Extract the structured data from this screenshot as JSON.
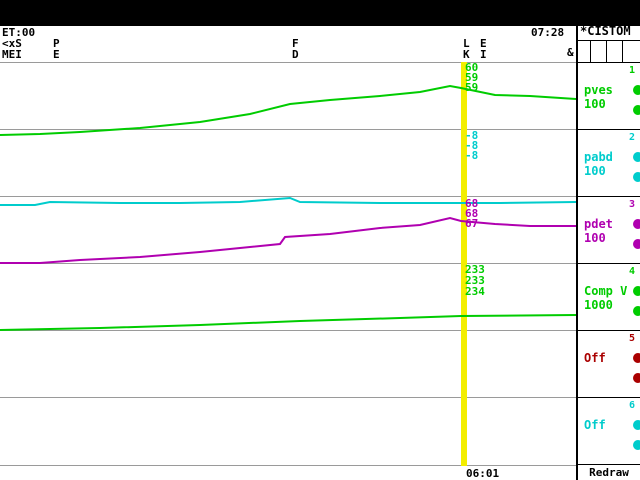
{
  "header": {
    "left_clock": "ET:00",
    "right_clock": "07:28",
    "title": "*CISTOM",
    "mode_labels": [
      "<xS",
      "MEI"
    ]
  },
  "markers": [
    {
      "label": "P\nE"
    },
    {
      "label": "F\nD"
    },
    {
      "label": "L\nK"
    },
    {
      "label": "E\nI"
    },
    {
      "label": "&"
    }
  ],
  "cursor": {
    "time": "06:01",
    "values": {
      "pves": [
        "60",
        "59",
        "59"
      ],
      "pabd": [
        "-8",
        "-8",
        "-8"
      ],
      "pdet": [
        "68",
        "68",
        "67"
      ],
      "compv": [
        "233",
        "233",
        "234"
      ]
    }
  },
  "channels": [
    {
      "num": "1",
      "name": "pves",
      "scale": "100",
      "color": "#00cc00"
    },
    {
      "num": "2",
      "name": "pabd",
      "scale": "100",
      "color": "#00cccc"
    },
    {
      "num": "3",
      "name": "pdet",
      "scale": "100",
      "color": "#b000b0"
    },
    {
      "num": "4",
      "name": "Comp V",
      "scale": "1000",
      "color": "#00cc00"
    },
    {
      "num": "5",
      "name": "Off",
      "scale": "",
      "color": "#aa0000"
    },
    {
      "num": "6",
      "name": "Off",
      "scale": "",
      "color": "#00cccc"
    }
  ],
  "buttons": {
    "redraw": "Redraw"
  }
}
